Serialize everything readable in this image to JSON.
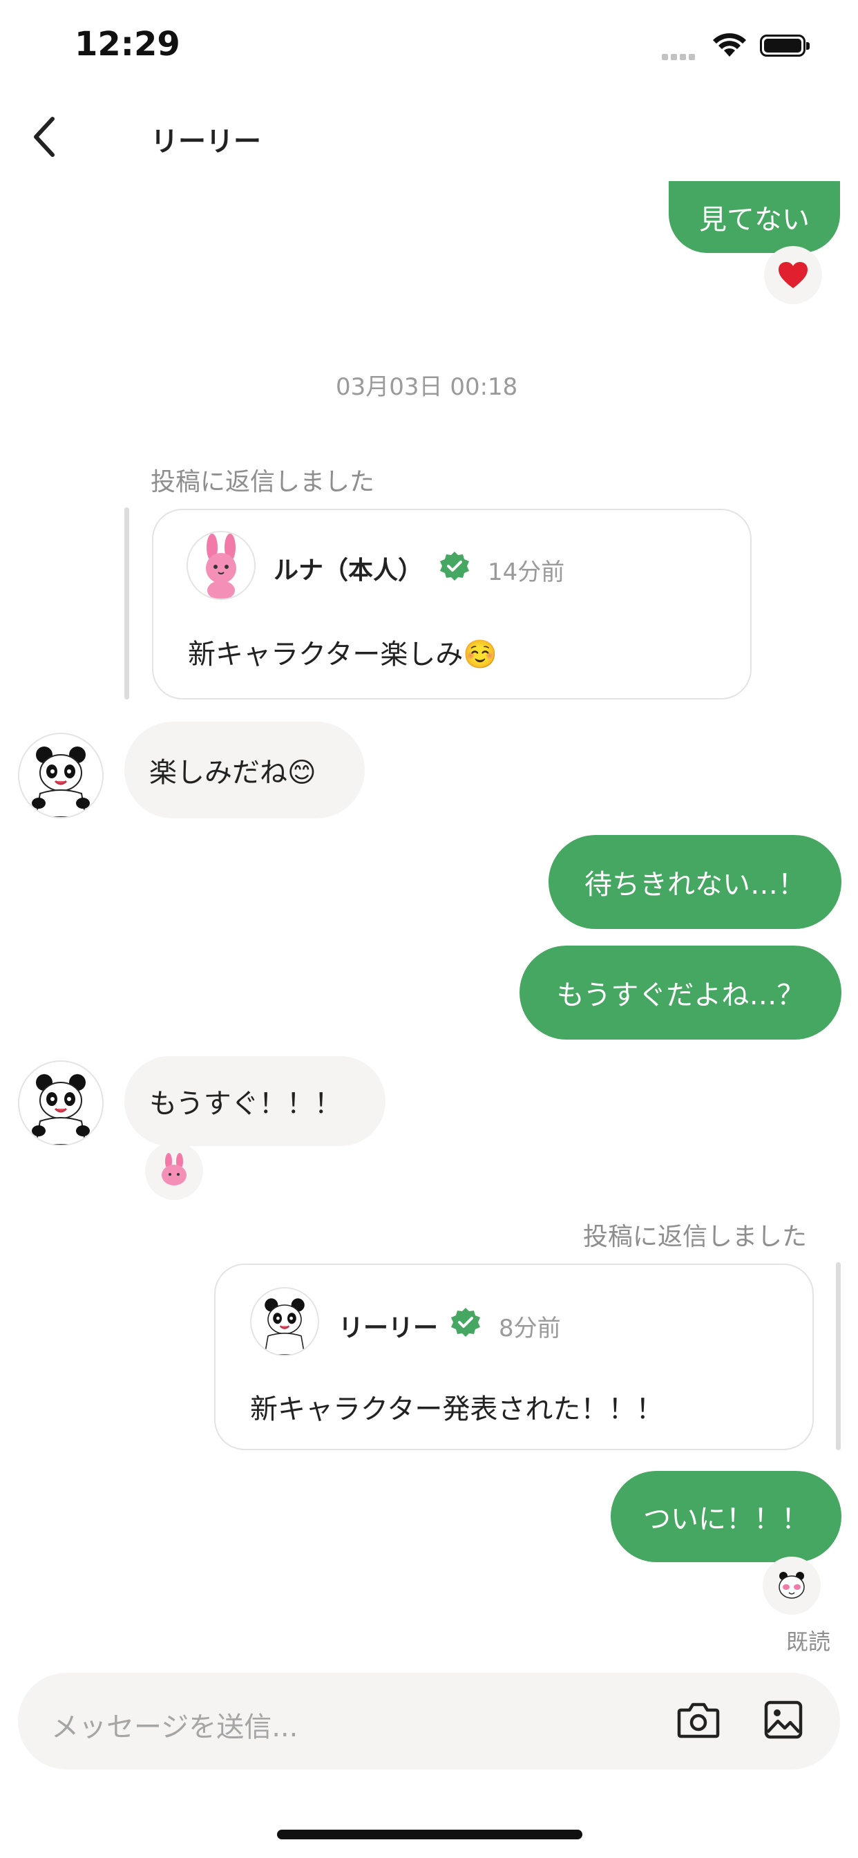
{
  "status_bar": {
    "time": "12:29"
  },
  "header": {
    "title": "リーリー"
  },
  "colors": {
    "accent_green": "#45a761",
    "bubble_gray": "#f5f4f2",
    "verified_green": "#45a761"
  },
  "messages": {
    "m1": {
      "text": "見てない",
      "reaction": "heart-emoji"
    },
    "date": "03月03日 00:18",
    "reply1_label": "投稿に返信しました",
    "reply1_card": {
      "name": "ルナ（本人）",
      "time": "14分前",
      "text": "新キャラクター楽しみ☺️"
    },
    "m2": {
      "text": "楽しみだね😊"
    },
    "m3": {
      "text": "待ちきれない…！"
    },
    "m4": {
      "text": "もうすぐだよね…？"
    },
    "m5": {
      "text": "もうすぐ！！！",
      "reaction": "bunny-reaction"
    },
    "reply2_label": "投稿に返信しました",
    "reply2_card": {
      "name": "リーリー",
      "time": "8分前",
      "text": "新キャラクター発表された！！！"
    },
    "m6": {
      "text": "ついに！！！",
      "read_status": "既読"
    }
  },
  "input": {
    "placeholder": "メッセージを送信..."
  }
}
